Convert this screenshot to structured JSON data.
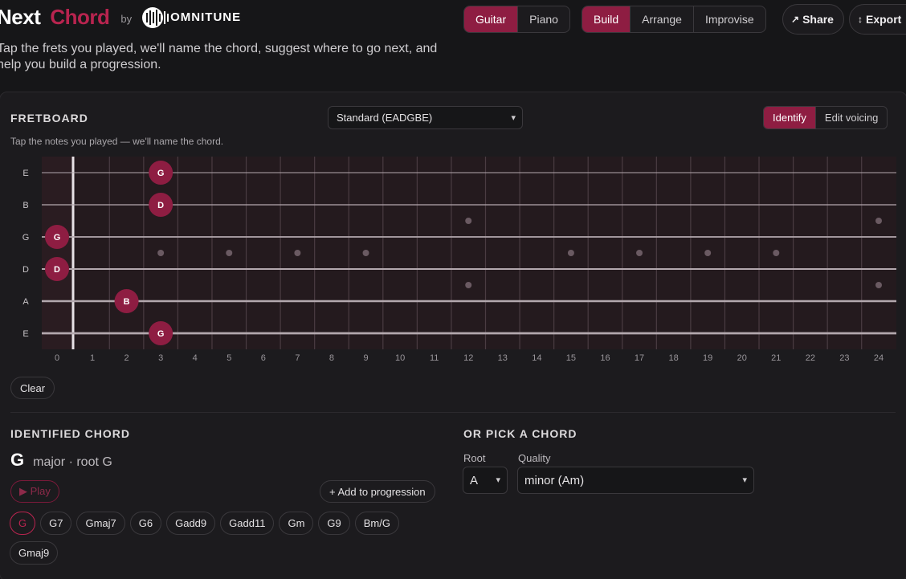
{
  "brand": {
    "word1": "Next",
    "word2": "Chord",
    "by": "by",
    "logo_text": "OMNITUNE"
  },
  "tagline": "Tap the frets you played, we'll name the chord, suggest where to go next, and help you build a progression.",
  "instrument_tabs": [
    {
      "label": "Guitar",
      "active": true
    },
    {
      "label": "Piano",
      "active": false
    }
  ],
  "mode_tabs": [
    {
      "label": "Build",
      "active": true
    },
    {
      "label": "Arrange",
      "active": false
    },
    {
      "label": "Improvise",
      "active": false
    }
  ],
  "share": {
    "icon": "↗",
    "label": "Share"
  },
  "export": {
    "icon": "↕",
    "label": "Export"
  },
  "fretboard": {
    "title": "FRETBOARD",
    "subtitle": "Tap the notes you played — we'll name the chord.",
    "tuning": "Standard (EADGBE)",
    "id_tabs": [
      {
        "label": "Identify",
        "active": true
      },
      {
        "label": "Edit voicing",
        "active": false
      }
    ],
    "strings": [
      "E",
      "B",
      "G",
      "D",
      "A",
      "E"
    ],
    "frets": 24,
    "single_inlays": [
      3,
      5,
      7,
      9,
      15,
      17,
      19,
      21
    ],
    "double_inlays": [
      12,
      24
    ],
    "notes": [
      {
        "string": 0,
        "fret": 3,
        "label": "G"
      },
      {
        "string": 1,
        "fret": 3,
        "label": "D"
      },
      {
        "string": 2,
        "fret": 0,
        "label": "G"
      },
      {
        "string": 3,
        "fret": 0,
        "label": "D"
      },
      {
        "string": 4,
        "fret": 2,
        "label": "B"
      },
      {
        "string": 5,
        "fret": 3,
        "label": "G"
      }
    ],
    "clear_label": "Clear"
  },
  "identified": {
    "title": "IDENTIFIED CHORD",
    "chord": "G",
    "description": "major · root G",
    "play_label": "▶ Play",
    "add_label": "+ Add to progression",
    "alternatives": [
      {
        "label": "G",
        "active": true
      },
      {
        "label": "G7",
        "active": false
      },
      {
        "label": "Gmaj7",
        "active": false
      },
      {
        "label": "G6",
        "active": false
      },
      {
        "label": "Gadd9",
        "active": false
      },
      {
        "label": "Gadd11",
        "active": false
      },
      {
        "label": "Gm",
        "active": false
      },
      {
        "label": "G9",
        "active": false
      },
      {
        "label": "Bm/G",
        "active": false
      },
      {
        "label": "Gmaj9",
        "active": false
      }
    ]
  },
  "picker": {
    "title": "OR PICK A CHORD",
    "root_label": "Root",
    "root_value": "A",
    "quality_label": "Quality",
    "quality_value": "minor (Am)"
  },
  "colors": {
    "accent": "#8e1d42",
    "accent_bright": "#b8244f",
    "background": "#161618",
    "panel": "#1c1b1e",
    "fretboard": "#241a1e"
  }
}
